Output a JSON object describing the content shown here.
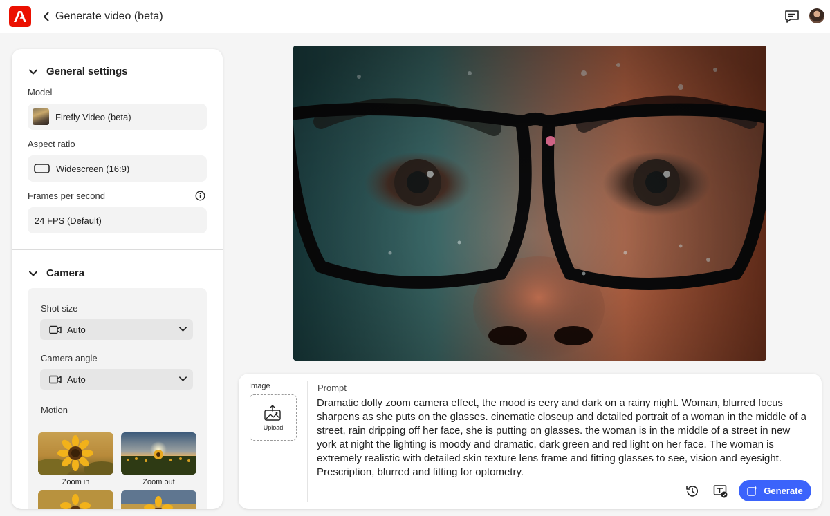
{
  "header": {
    "title": "Generate video (beta)",
    "logo_icon": "adobe-logo",
    "accent": "#eb1000"
  },
  "settings": {
    "general_title": "General settings",
    "model_label": "Model",
    "model_value": "Firefly Video (beta)",
    "aspect_label": "Aspect ratio",
    "aspect_value": "Widescreen (16:9)",
    "fps_label": "Frames per second",
    "fps_value": "24 FPS (Default)",
    "camera_title": "Camera",
    "shot_label": "Shot size",
    "shot_value": "Auto",
    "angle_label": "Camera angle",
    "angle_value": "Auto",
    "motion_label": "Motion",
    "motions": [
      {
        "label": "Zoom in"
      },
      {
        "label": "Zoom out"
      },
      {
        "label": ""
      },
      {
        "label": ""
      }
    ]
  },
  "prompt": {
    "image_label": "Image",
    "upload_label": "Upload",
    "prompt_label": "Prompt",
    "text": "Dramatic dolly zoom camera effect, the mood is eery and dark on a rainy night. Woman, blurred focus sharpens as she puts on the glasses. cinematic closeup and detailed portrait of a woman in the middle of a street, rain dripping off her face, she is putting on glasses. the woman is in the middle of a street in new york at night the lighting is moody and dramatic, dark green and red light on her face. The woman is extremely realistic with detailed skin texture lens frame and fitting glasses to see, vision and eyesight. Prescription, blurred and fitting for optometry.",
    "generate_label": "Generate",
    "generate_color": "#3b63fb"
  }
}
